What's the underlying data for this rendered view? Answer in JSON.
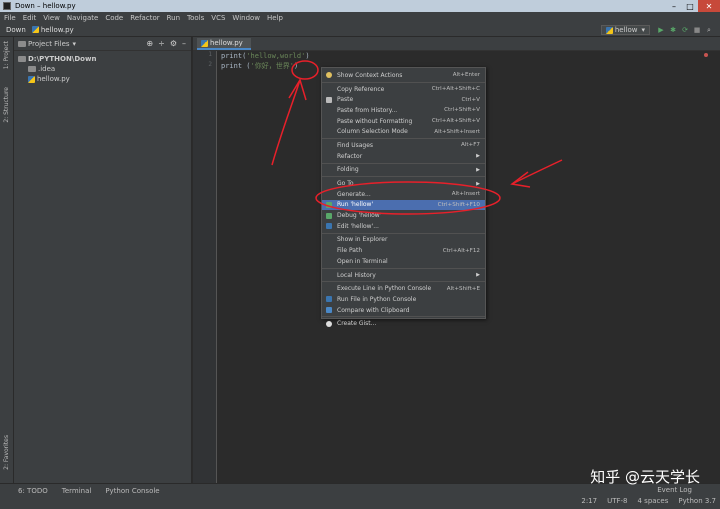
{
  "window": {
    "title": "Down – hellow.py",
    "min": "–",
    "max": "□",
    "close": "✕"
  },
  "menu": [
    "File",
    "Edit",
    "View",
    "Navigate",
    "Code",
    "Refactor",
    "Run",
    "Tools",
    "VCS",
    "Window",
    "Help"
  ],
  "nav": {
    "project": "Down",
    "file": "hellow.py"
  },
  "run_config": {
    "name": "hellow",
    "dropdown": "▾"
  },
  "run_buttons": [
    "▶",
    "✱",
    "⟳",
    "■",
    "⌕"
  ],
  "left_tabs": {
    "project": "1: Project",
    "structure": "2: Structure",
    "favorites": "2: Favorites"
  },
  "project_panel": {
    "title": "Project Files",
    "tree": [
      {
        "label": "D:\\PYTHON\\Down",
        "indent": 0
      },
      {
        "label": ".idea",
        "indent": 1
      },
      {
        "label": "hellow.py",
        "indent": 1
      }
    ]
  },
  "editor": {
    "tab": "hellow.py",
    "lines": [
      {
        "num": "1",
        "code_fn": "print",
        "code_open": "(",
        "code_str": "'hellow,world'",
        "code_close": ")"
      },
      {
        "num": "2",
        "code_fn": "print ",
        "code_open": "(",
        "code_str": "'你好，世界'",
        "code_close": ")"
      }
    ]
  },
  "context_menu": [
    {
      "label": "Show Context Actions",
      "shortcut": "Alt+Enter",
      "icon": "bulb-icon"
    },
    {
      "sep": true
    },
    {
      "label": "Copy Reference",
      "shortcut": "Ctrl+Alt+Shift+C"
    },
    {
      "label": "Paste",
      "shortcut": "Ctrl+V",
      "icon": "clipboard-icon"
    },
    {
      "label": "Paste from History...",
      "shortcut": "Ctrl+Shift+V"
    },
    {
      "label": "Paste without Formatting",
      "shortcut": "Ctrl+Alt+Shift+V"
    },
    {
      "label": "Column Selection Mode",
      "shortcut": "Alt+Shift+Insert"
    },
    {
      "sep": true
    },
    {
      "label": "Find Usages",
      "shortcut": "Alt+F7"
    },
    {
      "label": "Refactor",
      "submenu": true
    },
    {
      "sep": true
    },
    {
      "label": "Folding",
      "submenu": true
    },
    {
      "sep": true
    },
    {
      "label": "Go To",
      "submenu": true
    },
    {
      "label": "Generate...",
      "shortcut": "Alt+Insert"
    },
    {
      "label": "Run 'hellow'",
      "shortcut": "Ctrl+Shift+F10",
      "selected": true,
      "icon": "run-icon"
    },
    {
      "label": "Debug 'hellow'",
      "icon": "debug-icon"
    },
    {
      "label": "Edit 'hellow'...",
      "icon": "python-icon"
    },
    {
      "sep": true
    },
    {
      "label": "Show in Explorer"
    },
    {
      "label": "File Path",
      "shortcut": "Ctrl+Alt+F12"
    },
    {
      "label": "Open in Terminal"
    },
    {
      "sep": true
    },
    {
      "label": "Local History",
      "submenu": true
    },
    {
      "sep": true
    },
    {
      "label": "Execute Line in Python Console",
      "shortcut": "Alt+Shift+E"
    },
    {
      "label": "Run File in Python Console",
      "icon": "python-icon"
    },
    {
      "label": "Compare with Clipboard",
      "icon": "compare-icon"
    },
    {
      "sep": true
    },
    {
      "label": "Create Gist...",
      "icon": "github-icon"
    }
  ],
  "tool_windows": [
    "6: TODO",
    "Terminal",
    "Python Console"
  ],
  "status": {
    "position": "2:17",
    "encoding": "UTF-8",
    "indent": "4 spaces",
    "interpreter": "Python 3.7",
    "event_log": "Event Log"
  },
  "watermark": "知乎 @云天学长",
  "colors": {
    "selection": "#4b6eaf",
    "annotation": "#e8202a",
    "background": "#2b2b2b",
    "panel": "#3c3f41"
  }
}
